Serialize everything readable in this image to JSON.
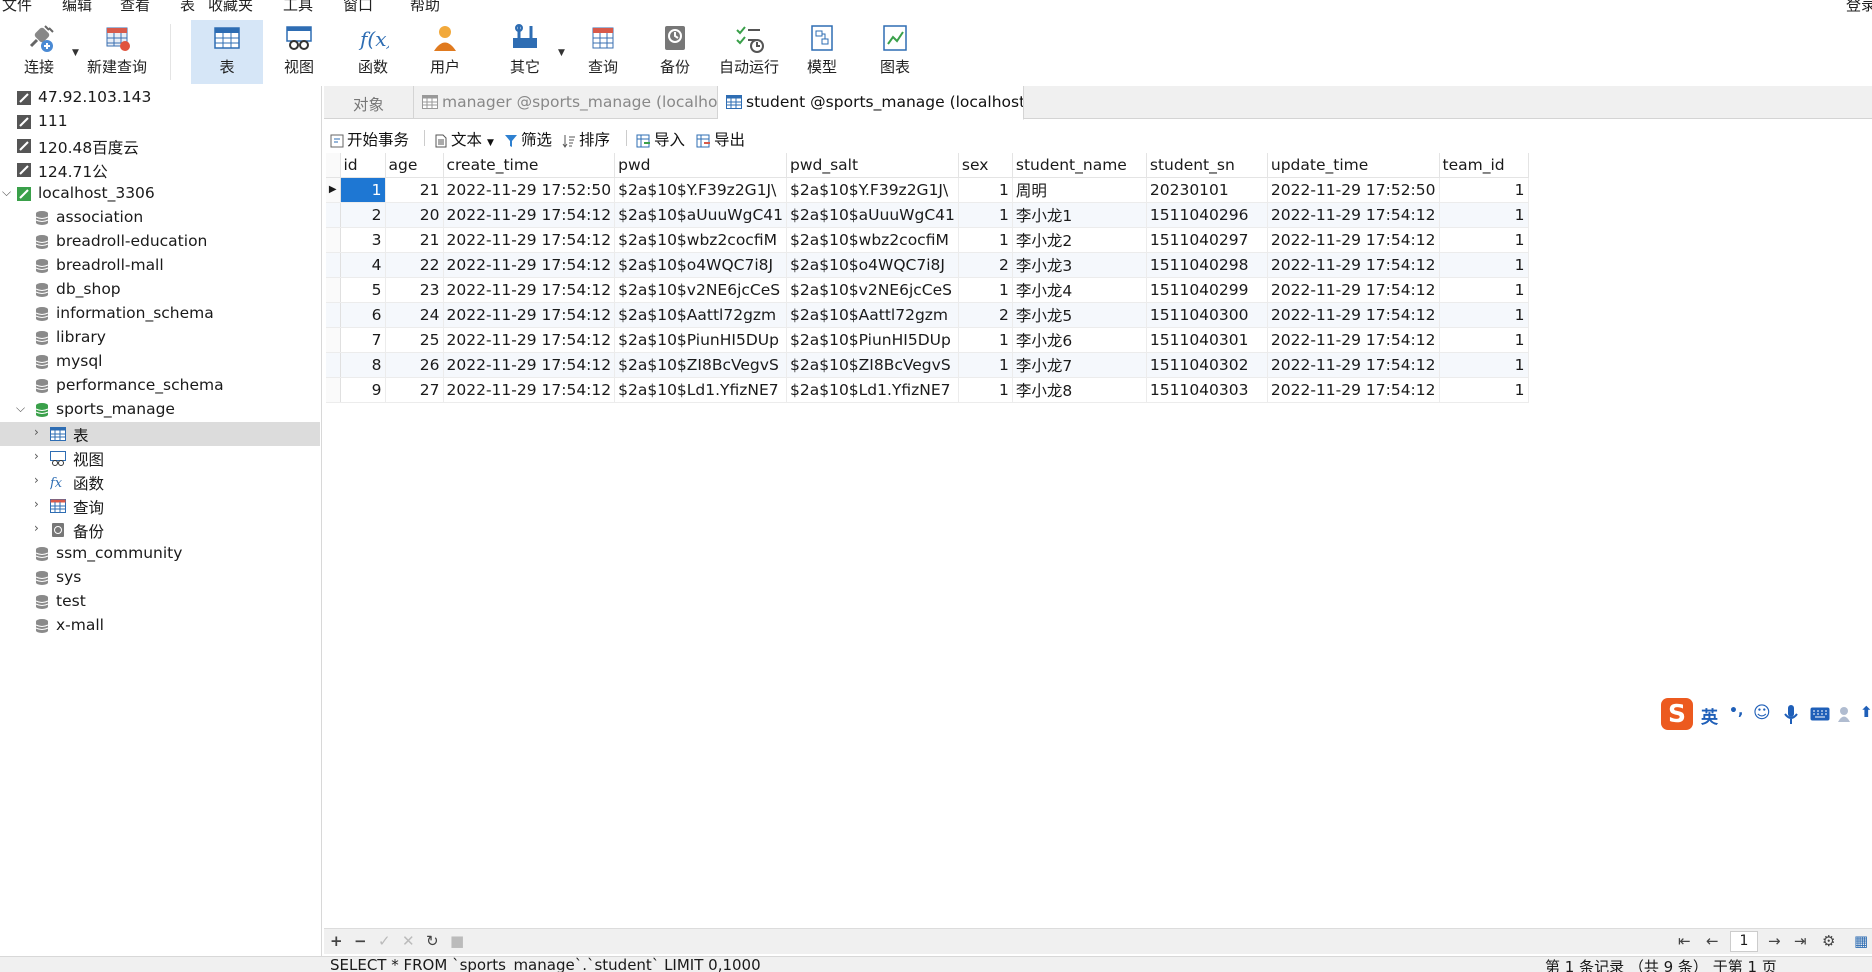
{
  "menu": {
    "items": [
      "文件",
      "编辑",
      "查看",
      "表",
      "收藏夹",
      "工具",
      "窗口",
      "帮助"
    ],
    "right_label": "登录"
  },
  "toolbar": {
    "connect": "连接",
    "new_query": "新建查询",
    "table": "表",
    "view": "视图",
    "function": "函数",
    "user": "用户",
    "other": "其它",
    "query": "查询",
    "backup": "备份",
    "autorun": "自动运行",
    "model": "模型",
    "chart": "图表"
  },
  "sidebar": {
    "connections": [
      {
        "label": "47.92.103.143"
      },
      {
        "label": "111"
      },
      {
        "label": "120.48百度云"
      },
      {
        "label": "124.71公"
      },
      {
        "label": "localhost_3306"
      }
    ],
    "databases_before": [
      "association",
      "breadroll-education",
      "breadroll-mall",
      "db_shop",
      "information_schema",
      "library",
      "mysql",
      "performance_schema"
    ],
    "open_db": "sports_manage",
    "open_db_children": [
      "表",
      "视图",
      "函数",
      "查询",
      "备份"
    ],
    "databases_after": [
      "ssm_community",
      "sys",
      "test",
      "x-mall"
    ]
  },
  "tabs": {
    "objects": "对象",
    "tab1": "manager @sports_manage (localhos...",
    "tab2": "student @sports_manage (localhost..."
  },
  "gridbar": {
    "begin_tx": "开始事务",
    "text": "文本",
    "filter": "筛选",
    "sort": "排序",
    "import": "导入",
    "export": "导出"
  },
  "table": {
    "columns": [
      "id",
      "age",
      "create_time",
      "pwd",
      "pwd_salt",
      "sex",
      "student_name",
      "student_sn",
      "update_time",
      "team_id"
    ],
    "rows": [
      [
        "1",
        "21",
        "2022-11-29 17:52:50",
        "$2a$10$Y.F39z2G1J\\",
        "$2a$10$Y.F39z2G1J\\",
        "1",
        "周明",
        "20230101",
        "2022-11-29 17:52:50",
        "1"
      ],
      [
        "2",
        "20",
        "2022-11-29 17:54:12",
        "$2a$10$aUuuWgC41",
        "$2a$10$aUuuWgC41",
        "1",
        "李小龙1",
        "1511040296",
        "2022-11-29 17:54:12",
        "1"
      ],
      [
        "3",
        "21",
        "2022-11-29 17:54:12",
        "$2a$10$wbz2cocfiM",
        "$2a$10$wbz2cocfiM",
        "1",
        "李小龙2",
        "1511040297",
        "2022-11-29 17:54:12",
        "1"
      ],
      [
        "4",
        "22",
        "2022-11-29 17:54:12",
        "$2a$10$o4WQC7i8J",
        "$2a$10$o4WQC7i8J",
        "2",
        "李小龙3",
        "1511040298",
        "2022-11-29 17:54:12",
        "1"
      ],
      [
        "5",
        "23",
        "2022-11-29 17:54:12",
        "$2a$10$v2NE6jcCeS",
        "$2a$10$v2NE6jcCeS",
        "1",
        "李小龙4",
        "1511040299",
        "2022-11-29 17:54:12",
        "1"
      ],
      [
        "6",
        "24",
        "2022-11-29 17:54:12",
        "$2a$10$Aattl72gzm",
        "$2a$10$Aattl72gzm",
        "2",
        "李小龙5",
        "1511040300",
        "2022-11-29 17:54:12",
        "1"
      ],
      [
        "7",
        "25",
        "2022-11-29 17:54:12",
        "$2a$10$PiunHI5DUp",
        "$2a$10$PiunHI5DUp",
        "1",
        "李小龙6",
        "1511040301",
        "2022-11-29 17:54:12",
        "1"
      ],
      [
        "8",
        "26",
        "2022-11-29 17:54:12",
        "$2a$10$ZI8BcVegvS",
        "$2a$10$ZI8BcVegvS",
        "1",
        "李小龙7",
        "1511040302",
        "2022-11-29 17:54:12",
        "1"
      ],
      [
        "9",
        "27",
        "2022-11-29 17:54:12",
        "$2a$10$Ld1.YfizNE7",
        "$2a$10$Ld1.YfizNE7",
        "1",
        "李小龙8",
        "1511040303",
        "2022-11-29 17:54:12",
        "1"
      ]
    ]
  },
  "nav": {
    "page": "1"
  },
  "status": {
    "sql": "SELECT * FROM `sports_manage`.`student` LIMIT 0,1000",
    "records": "第 1 条记录 （共 9 条） 于第 1 页"
  },
  "ime": {
    "lang": "英"
  },
  "colors": {
    "selection": "#1e77d3",
    "active_toolbar": "#d6e6f7",
    "sidebar_selected": "#dcdcdc"
  }
}
